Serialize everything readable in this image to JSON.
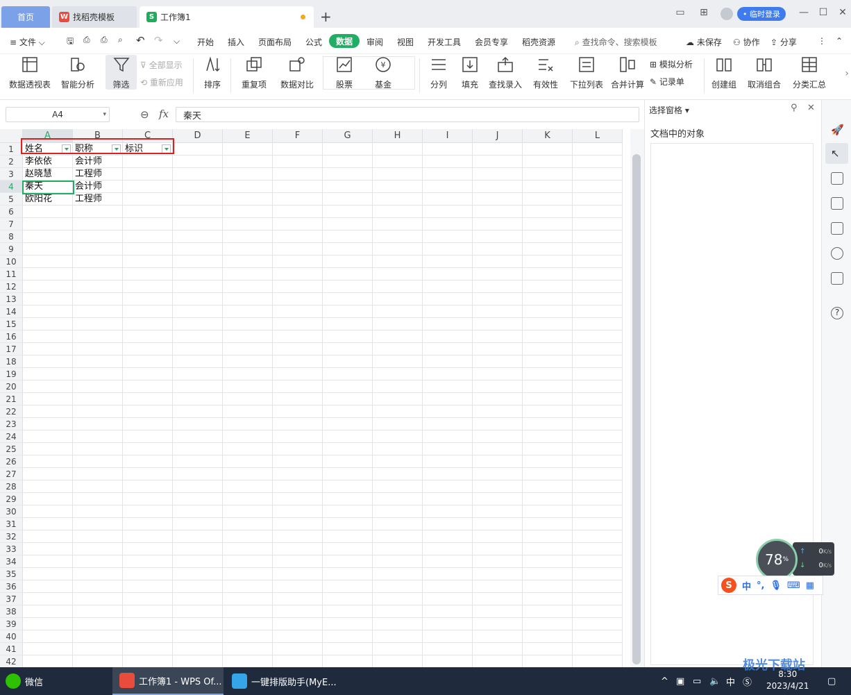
{
  "tabs": {
    "home": "首页",
    "doc1": "找稻壳模板",
    "doc2": "工作簿1",
    "doc1_icon": "wps-logo-icon",
    "doc2_icon": "S"
  },
  "titlebar": {
    "login": "• 临时登录"
  },
  "menu": {
    "file": "文件",
    "items": [
      "开始",
      "插入",
      "页面布局",
      "公式",
      "数据",
      "审阅",
      "视图",
      "开发工具",
      "会员专享",
      "稻壳资源"
    ],
    "active": "数据",
    "search": "查找命令、搜索模板",
    "unsaved": "未保存",
    "collab": "协作",
    "share": "分享"
  },
  "ribbon": {
    "pivot": "数据透视表",
    "smart": "智能分析",
    "filter": "筛选",
    "show_all": "全部显示",
    "reapply": "重新应用",
    "sort": "排序",
    "dup": "重复项",
    "compare": "数据对比",
    "stock": "股票",
    "fund": "基金",
    "split": "分列",
    "fill": "填充",
    "lookup": "查找录入",
    "validity": "有效性",
    "dropdown": "下拉列表",
    "merge": "合并计算",
    "simulate": "模拟分析",
    "record": "记录单",
    "group": "创建组",
    "ungroup": "取消组合",
    "subtotal": "分类汇总"
  },
  "formula": {
    "cell_ref": "A4",
    "fx": "fx",
    "value": "秦天"
  },
  "grid": {
    "columns": [
      "A",
      "B",
      "C",
      "D",
      "E",
      "F",
      "G",
      "H",
      "I",
      "J",
      "K",
      "L"
    ],
    "rows": [
      "1",
      "2",
      "3",
      "4",
      "5",
      "6",
      "7",
      "8",
      "9",
      "10",
      "11",
      "12",
      "13",
      "14",
      "15",
      "16",
      "17",
      "18",
      "19",
      "20",
      "21",
      "22",
      "23",
      "24",
      "25",
      "26",
      "27",
      "28",
      "29",
      "30",
      "31",
      "32",
      "33",
      "34",
      "35",
      "36",
      "37",
      "38",
      "39",
      "40",
      "41",
      "42"
    ],
    "headers": [
      "姓名",
      "职称",
      "标识"
    ],
    "data": [
      [
        "李依依",
        "会计师"
      ],
      [
        "赵晓慧",
        "工程师"
      ],
      [
        "秦天",
        "会计师"
      ],
      [
        "欧阳花",
        "工程师"
      ]
    ]
  },
  "pane": {
    "title": "选择窗格",
    "subtitle": "文档中的对象"
  },
  "widgets": {
    "speed": "78",
    "speed_unit": "%",
    "up": "0",
    "down": "0",
    "rate_unit": "K/s",
    "ime_lang": "中"
  },
  "taskbar": {
    "wechat": "微信",
    "wps": "工作簿1 - WPS Of...",
    "tool": "一键排版助手(MyE...",
    "ime": "中",
    "time": "8:30",
    "date": "2023/4/21",
    "watermark": "极光下载站"
  }
}
